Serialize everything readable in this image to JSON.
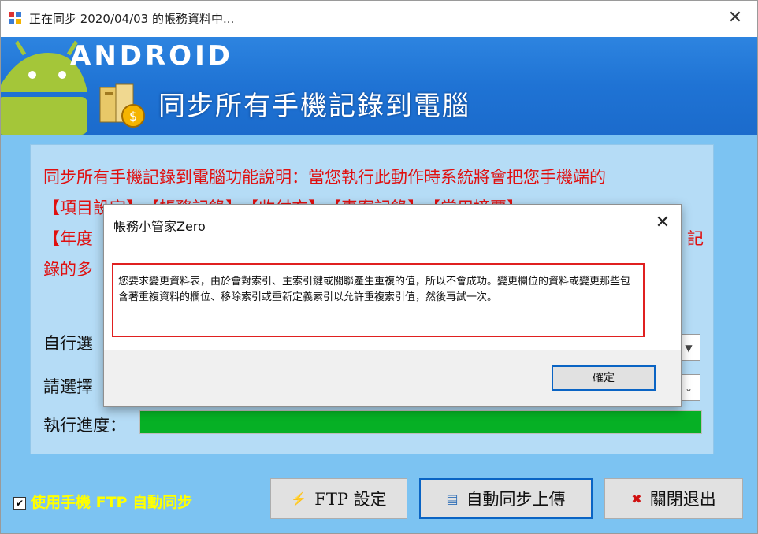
{
  "window": {
    "title": "正在同步 2020/04/03 的帳務資料中...",
    "close_glyph": "✕"
  },
  "banner": {
    "brand": "ANDROID",
    "headline": "同步所有手機記錄到電腦"
  },
  "panel": {
    "description_lines": [
      "同步所有手機記錄到電腦功能說明：當您執行此動作時系統將會把您手機端的",
      "【項目設定】、【帳務記錄】、【收付方】、【專案記錄】、【常用摘要】、",
      "【年度",
      "錄的多"
    ],
    "description_line3_right": "記",
    "row1_label": "自行選",
    "row2_label": "請選擇",
    "progress_label": "執行進度：",
    "progress_fraction": 1.0
  },
  "bottom": {
    "ftp_checkbox_label": "使用手機 FTP 自動同步",
    "ftp_settings_label": "FTP 設定",
    "auto_upload_label": "自動同步上傳",
    "exit_label": "關閉退出"
  },
  "dialog": {
    "title": "帳務小管家Zero",
    "message": "您要求變更資料表，由於會對索引、主索引鍵或關聯產生重複的值，所以不會成功。變更欄位的資料或變更那些包含著重複資料的欄位、移除索引或重新定義索引以允許重複索引值，然後再試一次。",
    "ok_label": "確定"
  },
  "colors": {
    "banner": "#1f73d4",
    "body": "#7cc3f2",
    "panel": "#b5dcf6",
    "desc": "#e01010",
    "progress": "#06b025",
    "checkbox_text": "#ffff00"
  }
}
